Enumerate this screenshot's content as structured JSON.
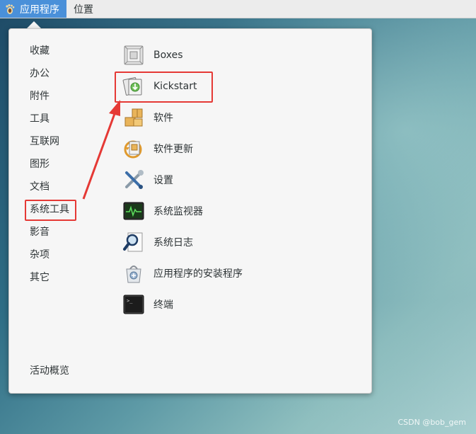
{
  "topbar": {
    "apps_label": "应用程序",
    "places_label": "位置"
  },
  "categories": [
    {
      "label": "收藏"
    },
    {
      "label": "办公"
    },
    {
      "label": "附件"
    },
    {
      "label": "工具"
    },
    {
      "label": "互联网"
    },
    {
      "label": "图形"
    },
    {
      "label": "文档"
    },
    {
      "label": "系统工具",
      "selected": true
    },
    {
      "label": "影音"
    },
    {
      "label": "杂项"
    },
    {
      "label": "其它"
    }
  ],
  "activities_label": "活动概览",
  "apps": [
    {
      "label": "Boxes",
      "icon": "boxes-icon"
    },
    {
      "label": "Kickstart",
      "icon": "kickstart-icon",
      "highlighted": true
    },
    {
      "label": "软件",
      "icon": "software-icon"
    },
    {
      "label": "软件更新",
      "icon": "software-update-icon"
    },
    {
      "label": "设置",
      "icon": "settings-icon"
    },
    {
      "label": "系统监视器",
      "icon": "system-monitor-icon"
    },
    {
      "label": "系统日志",
      "icon": "system-log-icon"
    },
    {
      "label": "应用程序的安装程序",
      "icon": "app-installer-icon"
    },
    {
      "label": "终端",
      "icon": "terminal-icon"
    }
  ],
  "annotation_color": "#e53935",
  "watermark": "CSDN @bob_gem"
}
